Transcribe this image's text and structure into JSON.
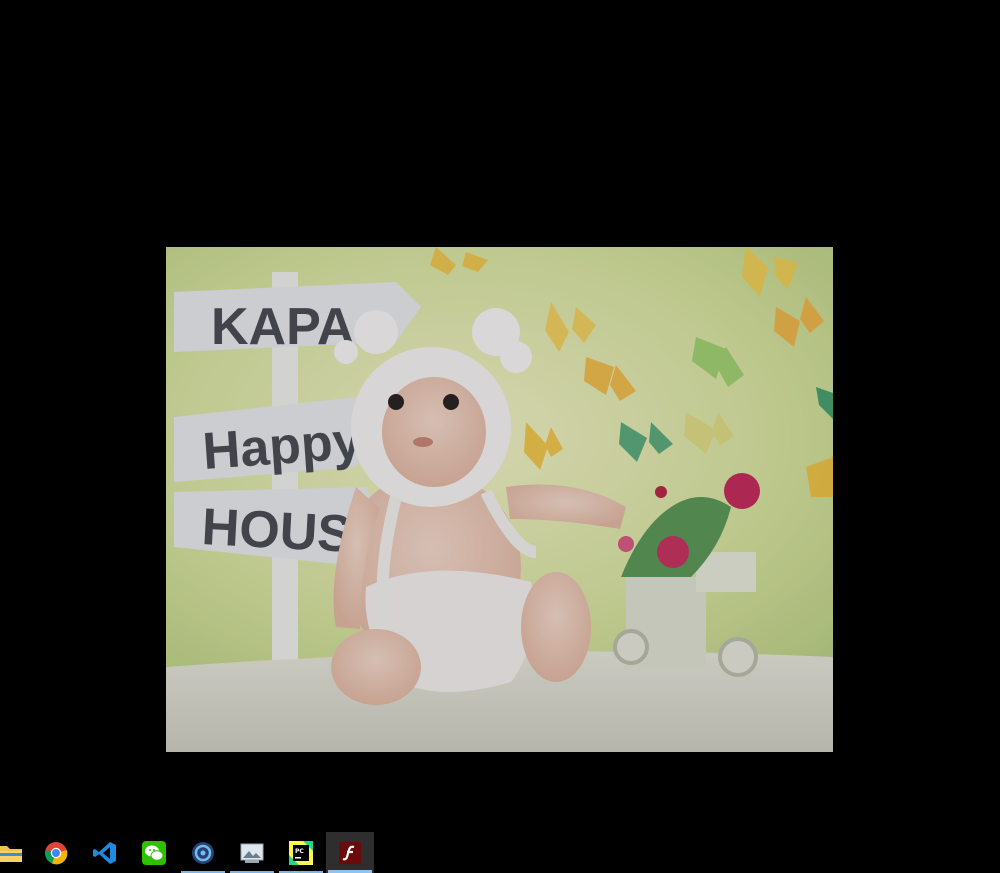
{
  "photo": {
    "signs": [
      "KAPA",
      "Happy",
      "HOUS"
    ]
  },
  "taskbar": {
    "apps": [
      {
        "name": "File Explorer",
        "icon": "folder-icon",
        "running": false
      },
      {
        "name": "Google Chrome",
        "icon": "chrome-icon",
        "running": false
      },
      {
        "name": "Visual Studio Code",
        "icon": "vscode-icon",
        "running": false
      },
      {
        "name": "WeChat",
        "icon": "wechat-icon",
        "running": false
      },
      {
        "name": "App",
        "icon": "circle-app-icon",
        "running": true
      },
      {
        "name": "Photos",
        "icon": "photos-icon",
        "running": true
      },
      {
        "name": "PyCharm",
        "icon": "pycharm-icon",
        "running": true
      },
      {
        "name": "Flash Player",
        "icon": "flash-icon",
        "running": true,
        "active": true
      }
    ]
  },
  "colors": {
    "background": "#000000",
    "taskbar_indicator": "#7fb6e6",
    "active_item": "#2e2e2e"
  }
}
